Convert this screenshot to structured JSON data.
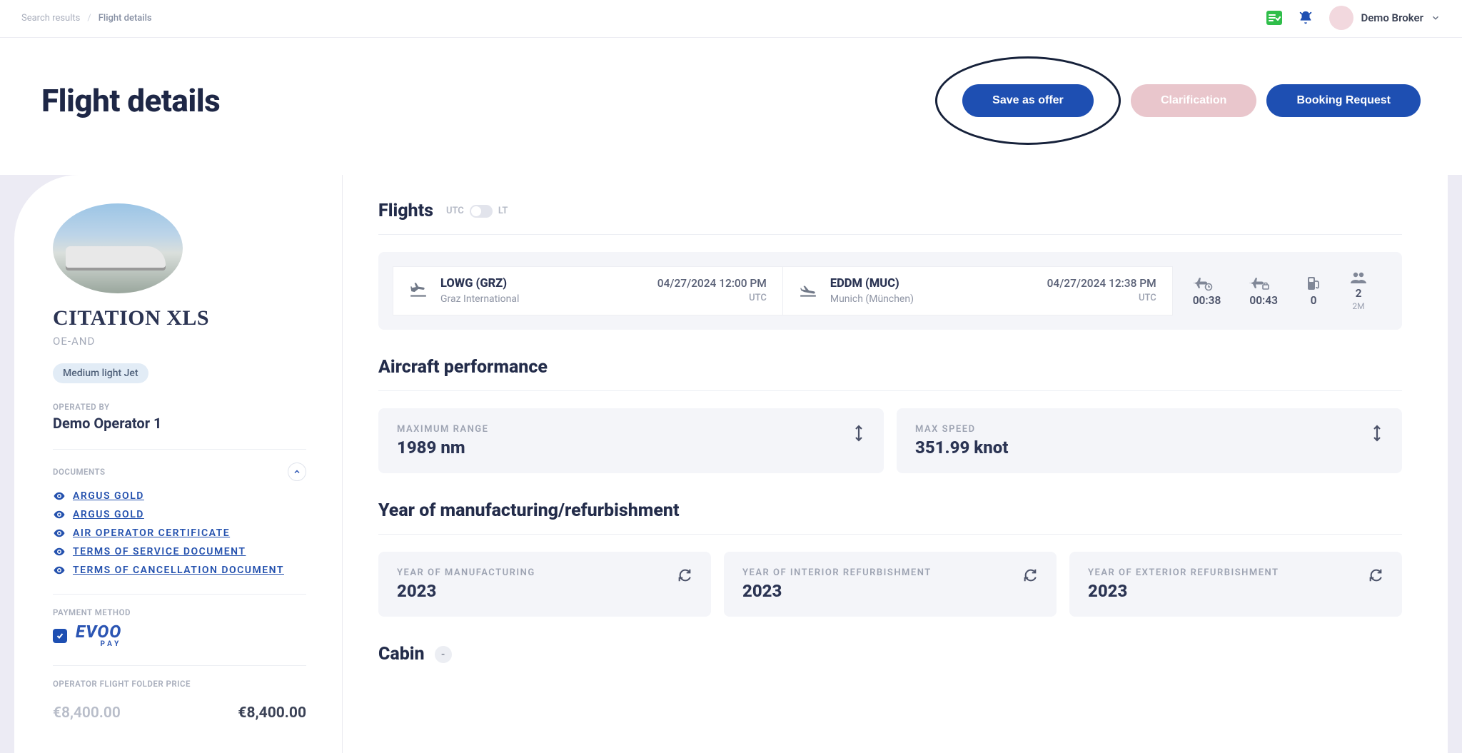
{
  "breadcrumb": {
    "root": "Search results",
    "current": "Flight details"
  },
  "user": {
    "name": "Demo Broker"
  },
  "header": {
    "title": "Flight details",
    "save_offer": "Save as offer",
    "clarification": "Clarification",
    "booking": "Booking Request"
  },
  "aircraft": {
    "model": "CITATION XLS",
    "reg": "OE-AND",
    "category": "Medium light Jet"
  },
  "operator": {
    "label": "OPERATED BY",
    "name": "Demo Operator 1"
  },
  "docs": {
    "label": "DOCUMENTS",
    "items": [
      "ARGUS GOLD",
      "ARGUS GOLD",
      "AIR OPERATOR CERTIFICATE",
      "TERMS OF SERVICE DOCUMENT",
      "TERMS OF CANCELLATION DOCUMENT"
    ]
  },
  "payment": {
    "label": "PAYMENT METHOD",
    "brand": "EVOO",
    "brand_sub": "PAY"
  },
  "price": {
    "label": "OPERATOR FLIGHT FOLDER PRICE",
    "base": "€8,400.00",
    "total": "€8,400.00"
  },
  "flights": {
    "title": "Flights",
    "tz_utc": "UTC",
    "tz_lt": "LT",
    "origin": {
      "code": "LOWG (GRZ)",
      "name": "Graz International",
      "datetime": "04/27/2024 12:00 PM",
      "tz": "UTC"
    },
    "dest": {
      "code": "EDDM (MUC)",
      "name": "Munich (München)",
      "datetime": "04/27/2024 12:38 PM",
      "tz": "UTC"
    },
    "duration": "00:38",
    "block": "00:43",
    "fuel_stops": "0",
    "pax": "2",
    "pax_sub": "2M"
  },
  "perf": {
    "title": "Aircraft performance",
    "range_label": "MAXIMUM RANGE",
    "range_value": "1989 nm",
    "speed_label": "MAX SPEED",
    "speed_value": "351.99 knot"
  },
  "year": {
    "title": "Year of manufacturing/refurbishment",
    "manu_label": "YEAR OF MANUFACTURING",
    "manu_value": "2023",
    "int_label": "YEAR OF INTERIOR REFURBISHMENT",
    "int_value": "2023",
    "ext_label": "YEAR OF EXTERIOR REFURBISHMENT",
    "ext_value": "2023"
  },
  "cabin": {
    "title": "Cabin",
    "indicator": "-"
  }
}
